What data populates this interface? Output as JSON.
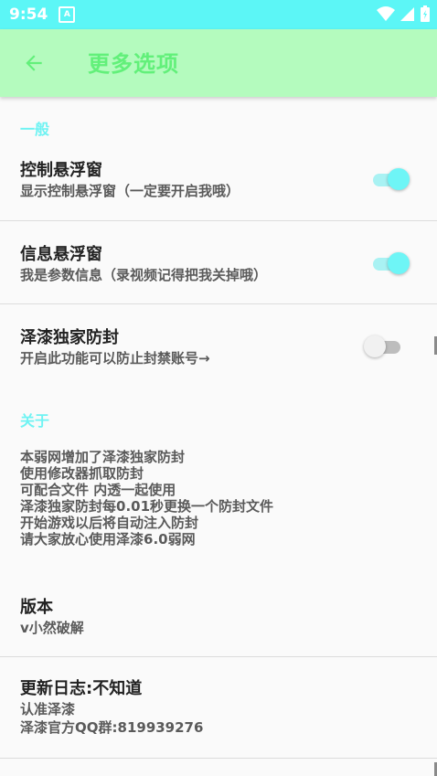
{
  "status_bar": {
    "time": "9:54",
    "notification": "A"
  },
  "app_bar": {
    "title": "更多选项"
  },
  "sections": {
    "general": "一般",
    "about": "关于"
  },
  "prefs": [
    {
      "title": "控制悬浮窗",
      "summary": "显示控制悬浮窗（一定要开启我哦）",
      "switch": true
    },
    {
      "title": "信息悬浮窗",
      "summary": "我是参数信息（录视频记得把我关掉哦）",
      "switch": true
    },
    {
      "title": "泽漆独家防封",
      "summary": "开启此功能可以防止封禁账号→",
      "switch": false
    }
  ],
  "about": {
    "lines": [
      "本弱网增加了泽漆独家防封",
      "使用修改器抓取防封",
      "可配合文件 内透一起使用",
      "泽漆独家防封每0.01秒更换一个防封文件",
      "开始游戏以后将自动注入防封",
      "请大家放心使用泽漆6.0弱网"
    ],
    "version_title": "版本",
    "version_value": "v小然破解",
    "changelog_title": "更新日志:不知道",
    "changelog_lines": [
      "认准泽漆",
      "泽漆官方QQ群:819939276"
    ]
  },
  "colors": {
    "status_bar": "#5cf6f6",
    "app_bar": "#b4fbbe",
    "accent": "#6ef5f6",
    "title_green": "#62f07a"
  }
}
